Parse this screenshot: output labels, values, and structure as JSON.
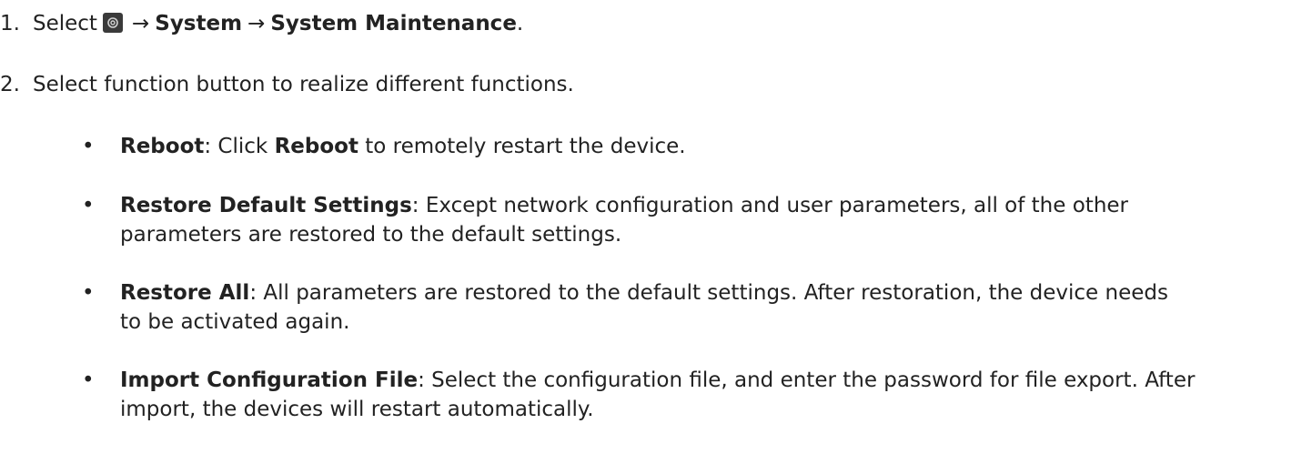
{
  "step1": {
    "number": "1.",
    "select": "Select",
    "icon": "settings-gear-icon",
    "arrow": "→",
    "system": "System",
    "maintenance": "System Maintenance",
    "end": "."
  },
  "step2": {
    "number": "2.",
    "text": "Select function button to realize different functions."
  },
  "bullets": [
    {
      "term": "Reboot",
      "desc_prefix": ": Click ",
      "bold_inline": "Reboot",
      "desc_suffix": " to remotely restart the device."
    },
    {
      "term": "Restore Default Settings",
      "line1": ": Except network configuration and user parameters, all of the other",
      "line2": "parameters are restored to the default settings."
    },
    {
      "term": "Restore All",
      "line1": ": All parameters are restored to the default settings. After restoration, the device needs",
      "line2": "to be activated again."
    },
    {
      "term": "Import Configuration File",
      "line1": ": Select the configuration file, and enter the password for file export. After",
      "line2": "import, the devices will restart automatically."
    }
  ],
  "bullet_char": "•"
}
